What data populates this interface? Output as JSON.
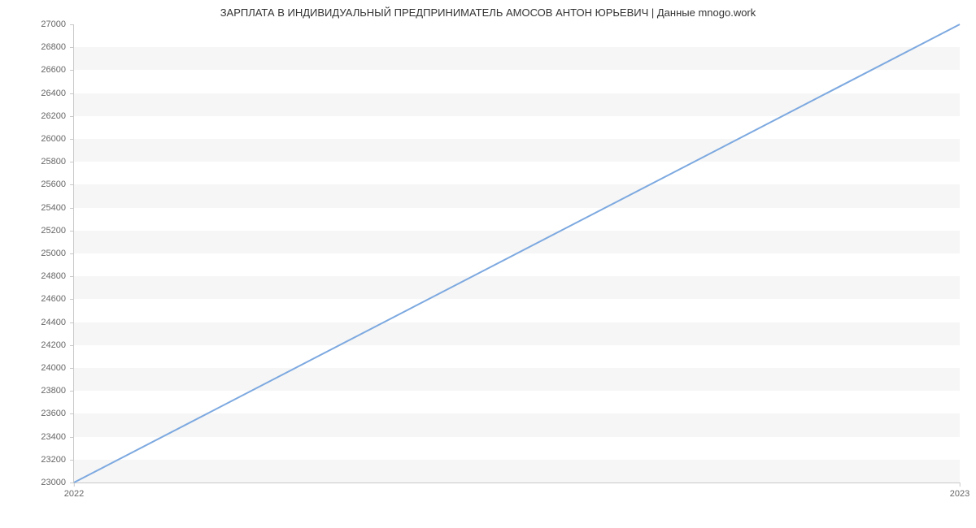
{
  "chart_data": {
    "type": "line",
    "title": "ЗАРПЛАТА В ИНДИВИДУАЛЬНЫЙ ПРЕДПРИНИМАТЕЛЬ АМОСОВ АНТОН ЮРЬЕВИЧ | Данные mnogo.work",
    "x": [
      2022,
      2023
    ],
    "values": [
      23000,
      27000
    ],
    "xlabel": "",
    "ylabel": "",
    "xlim": [
      2022,
      2023
    ],
    "ylim": [
      23000,
      27000
    ],
    "y_ticks": [
      23000,
      23200,
      23400,
      23600,
      23800,
      24000,
      24200,
      24400,
      24600,
      24800,
      25000,
      25200,
      25400,
      25600,
      25800,
      26000,
      26200,
      26400,
      26600,
      26800,
      27000
    ],
    "x_ticks": [
      2022,
      2023
    ],
    "colors": {
      "line": "#7da9e0",
      "band": "#f6f6f6",
      "axis": "#c9c9c9",
      "text": "#666666"
    }
  }
}
